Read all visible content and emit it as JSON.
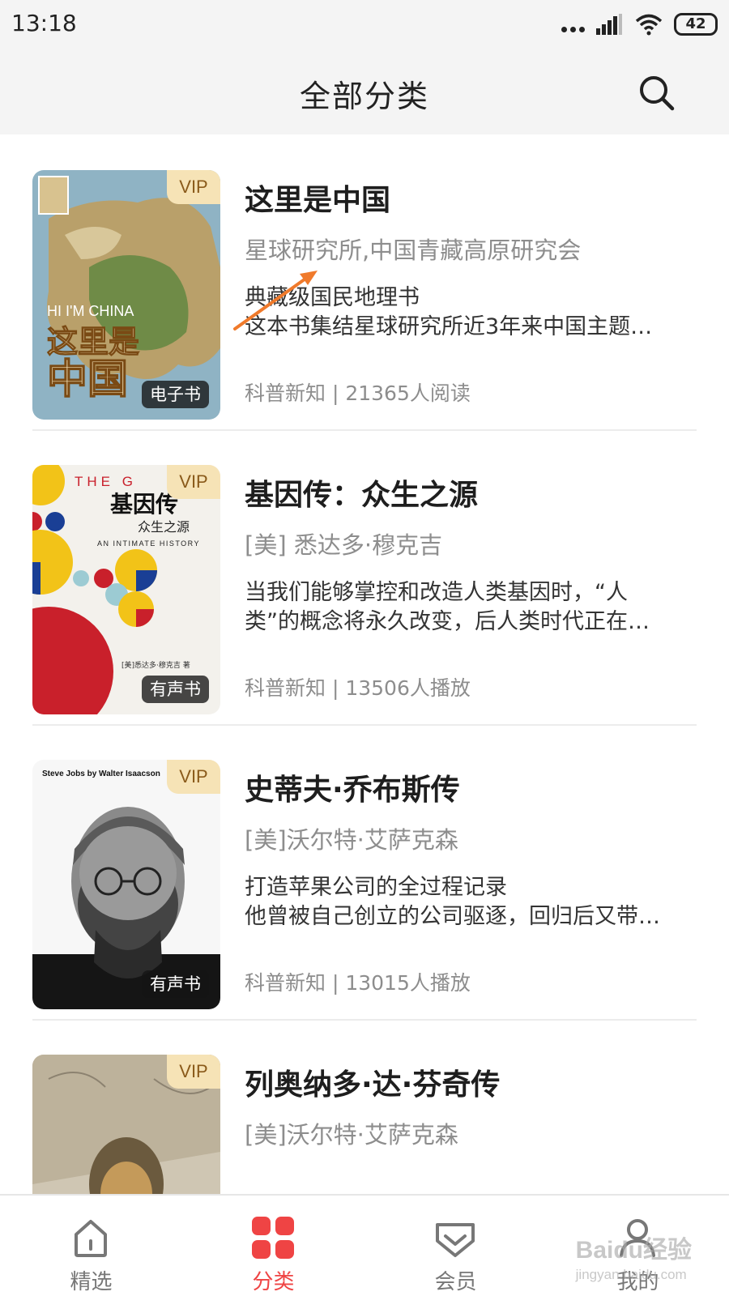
{
  "status_bar": {
    "time": "13:18",
    "battery": "42",
    "icons": [
      "dots-icon",
      "signal-icon",
      "wifi-icon",
      "battery-icon"
    ]
  },
  "header": {
    "title": "全部分类",
    "search_icon": "search-icon"
  },
  "books": [
    {
      "title": "这里是中国",
      "author": "星球研究所,中国青藏高原研究会",
      "desc_line1": "典藏级国民地理书",
      "desc_line2": "这本书集结星球研究所近3年来中国主题…",
      "meta": "科普新知 | 21365人阅读",
      "vip": "VIP",
      "type": "电子书",
      "cover_title": "这里是中国",
      "cover_subtitle": "HI I'M CHINA"
    },
    {
      "title": "基因传：众生之源",
      "author": "[美] 悉达多·穆克吉",
      "desc_line1": "当我们能够掌控和改造人类基因时，“人",
      "desc_line2": "类”的概念将永久改变，后人类时代正在…",
      "meta": "科普新知 | 13506人播放",
      "vip": "VIP",
      "type": "有声书",
      "cover_title": "基因传",
      "cover_subtitle": "众生之源",
      "cover_en": "AN INTIMATE HISTORY",
      "cover_top": "THE G"
    },
    {
      "title": "史蒂夫·乔布斯传",
      "author": "[美]沃尔特·艾萨克森",
      "desc_line1": "打造苹果公司的全过程记录",
      "desc_line2": "他曾被自己创立的公司驱逐，回归后又带…",
      "meta": "科普新知 | 13015人播放",
      "vip": "VIP",
      "type": "有声书",
      "cover_title": "Steve Jobs by Walter Isaacson"
    },
    {
      "title": "列奥纳多·达·芬奇传",
      "author": "[美]沃尔特·艾萨克森",
      "vip": "VIP"
    }
  ],
  "bottom_nav": [
    {
      "label": "精选",
      "icon": "home-icon",
      "active": false
    },
    {
      "label": "分类",
      "icon": "category-grid-icon",
      "active": true
    },
    {
      "label": "会员",
      "icon": "vip-diamond-icon",
      "active": false
    },
    {
      "label": "我的",
      "icon": "profile-icon",
      "active": false
    }
  ],
  "watermark": {
    "text": "Baidu经验",
    "sub": "jingyan.baidu.com"
  },
  "colors": {
    "accent": "#ef4444",
    "vip_bg": "#f6e3b6",
    "vip_text": "#8a5a1a",
    "annotation": "#f07a2b"
  }
}
